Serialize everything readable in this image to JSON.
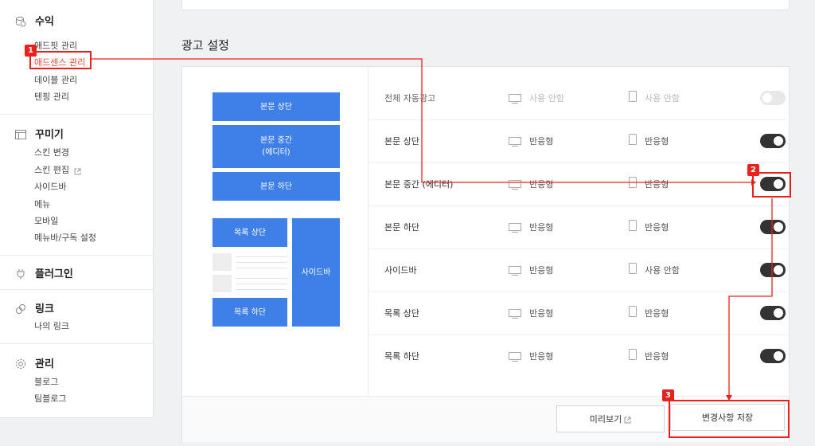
{
  "sidebar": {
    "sections": [
      {
        "icon": "coins-icon",
        "title": "수익",
        "items": [
          "애드핏 관리",
          "애드센스 관리",
          "데이블 관리",
          "텐핑 관리"
        ]
      },
      {
        "icon": "layout-icon",
        "title": "꾸미기",
        "items": [
          "스킨 변경",
          "스킨 편집",
          "사이드바",
          "메뉴",
          "모바일",
          "메뉴바/구독 설정"
        ]
      },
      {
        "icon": "plug-icon",
        "title": "플러그인",
        "items": []
      },
      {
        "icon": "link-icon",
        "title": "링크",
        "items": [
          "나의 링크"
        ]
      },
      {
        "icon": "gear-icon",
        "title": "관리",
        "items": [
          "블로그",
          "팀블로그"
        ]
      }
    ]
  },
  "main": {
    "heading": "광고 설정",
    "preview": {
      "top": "본문 상단",
      "middle_line1": "본문 중간",
      "middle_line2": "(에디터)",
      "bottom": "본문 하단",
      "list_top": "목록 상단",
      "list_bottom": "목록 하단",
      "sidebar": "사이드바"
    },
    "rows": [
      {
        "label": "전체 자동광고",
        "pc": "사용 안함",
        "mobile": "사용 안함",
        "on": false
      },
      {
        "label": "본문 상단",
        "pc": "반응형",
        "mobile": "반응형",
        "on": true
      },
      {
        "label": "본문 중간 (에디터)",
        "pc": "반응형",
        "mobile": "반응형",
        "on": true
      },
      {
        "label": "본문 하단",
        "pc": "반응형",
        "mobile": "반응형",
        "on": true
      },
      {
        "label": "사이드바",
        "pc": "반응형",
        "mobile": "사용 안함",
        "on": true
      },
      {
        "label": "목록 상단",
        "pc": "반응형",
        "mobile": "반응형",
        "on": true
      },
      {
        "label": "목록 하단",
        "pc": "반응형",
        "mobile": "반응형",
        "on": true
      }
    ],
    "buttons": {
      "preview": "미리보기",
      "save": "변경사항 저장"
    }
  },
  "annotations": {
    "n1": "1",
    "n2": "2",
    "n3": "3",
    "color": "#e8211d"
  },
  "colors": {
    "accent_blue": "#3f7fe8",
    "active_menu": "#ec4a3b"
  }
}
